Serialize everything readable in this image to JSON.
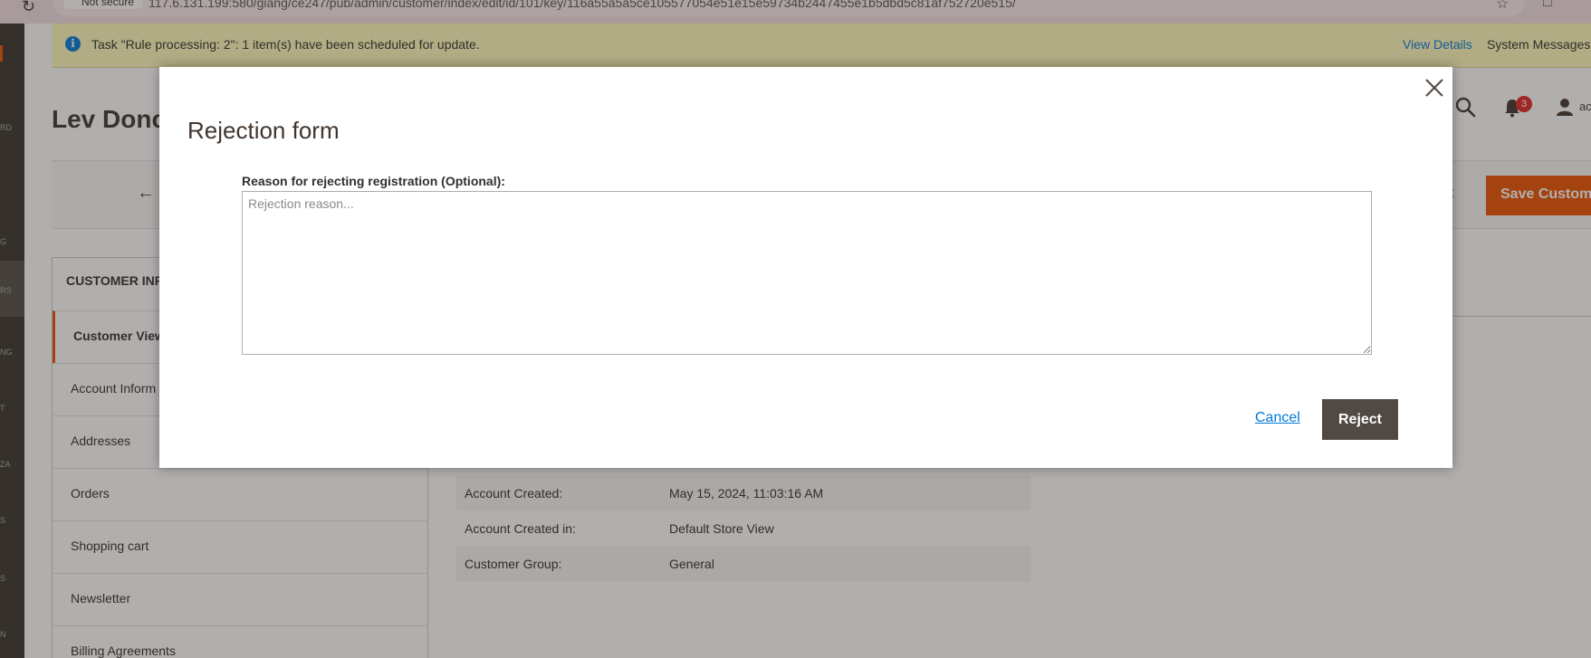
{
  "browser": {
    "security_label": "Not secure",
    "url": "117.6.131.199:580/giang/ce247/pub/admin/customer/index/edit/id/101/key/116a55a5a5ce105577054e51e15e59734b2447455e1b5dbd5c81af752720e515/"
  },
  "admin_nav": {
    "labels": [
      "RD",
      "G",
      "RS",
      "NG",
      "T",
      "ZA",
      "S",
      "S",
      "N"
    ]
  },
  "notice": {
    "message": "Task \"Rule processing: 2\": 1 item(s) have been scheduled for update.",
    "view_details": "View Details",
    "system_messages": "System Messages"
  },
  "header": {
    "title": "Lev Dono",
    "notification_count": "3",
    "username": "ac"
  },
  "toolbar": {
    "partial_button": "t",
    "save_label": "Save Custom"
  },
  "sidebar": {
    "heading": "CUSTOMER INF",
    "tabs": [
      {
        "label": "Customer View"
      },
      {
        "label": "Account Inform"
      },
      {
        "label": "Addresses"
      },
      {
        "label": "Orders"
      },
      {
        "label": "Shopping cart"
      },
      {
        "label": "Newsletter"
      },
      {
        "label": "Billing Agreements"
      }
    ]
  },
  "account_info": [
    {
      "key": "Account Created:",
      "value": "May 15, 2024, 11:03:16 AM"
    },
    {
      "key": "Account Created in:",
      "value": "Default Store View"
    },
    {
      "key": "Customer Group:",
      "value": "General"
    }
  ],
  "modal": {
    "title": "Rejection form",
    "field_label": "Reason for rejecting registration (Optional):",
    "placeholder": "Rejection reason...",
    "value": "",
    "cancel_label": "Cancel",
    "reject_label": "Reject"
  },
  "colors": {
    "accent": "#eb5202",
    "link": "#007bdb",
    "primary_button": "#514943",
    "notice_bg": "#fffbbb"
  }
}
